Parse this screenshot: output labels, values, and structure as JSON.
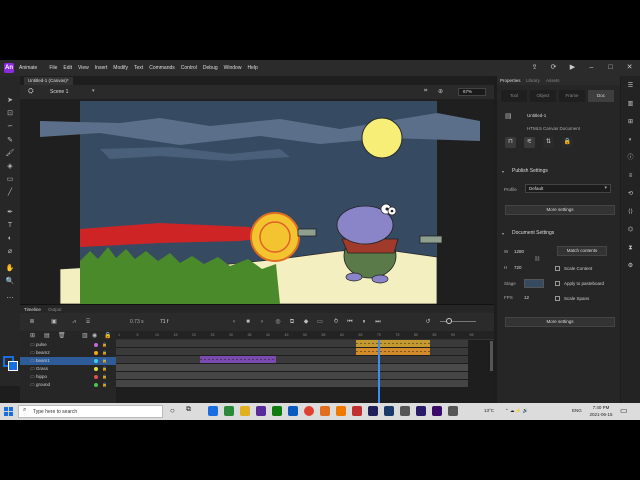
{
  "app": {
    "logo": "An",
    "name": "Animate",
    "menu": [
      "File",
      "Edit",
      "View",
      "Insert",
      "Modify",
      "Text",
      "Commands",
      "Control",
      "Debug",
      "Window",
      "Help"
    ],
    "window_icons": [
      "share-icon",
      "sync-icon",
      "play-icon",
      "minimize-icon",
      "maximize-icon",
      "close-icon"
    ]
  },
  "document": {
    "tab": "Untitled-1 (Canvas)*",
    "scene": "Scene 1",
    "zoom": "67%"
  },
  "timeline": {
    "tabs": [
      "Timeline",
      "Output"
    ],
    "frame_time": "0.73",
    "frame_time_unit": "s",
    "frame_number": "71",
    "frame_unit": "f",
    "ruler_ticks": [
      "1",
      "5",
      "10",
      "15",
      "20",
      "25",
      "30",
      "35",
      "40",
      "45",
      "50",
      "55",
      "60",
      "65",
      "70",
      "75",
      "80",
      "85",
      "90",
      "95"
    ],
    "layers": [
      {
        "name": "pulse",
        "dot": "#c06ad8",
        "selected": false
      },
      {
        "name": "beam2",
        "dot": "#f4a623",
        "selected": false
      },
      {
        "name": "beam1",
        "dot": "#3ecfee",
        "selected": true
      },
      {
        "name": "Grass",
        "dot": "#e0e04a",
        "selected": false
      },
      {
        "name": "hippo",
        "dot": "#e05050",
        "selected": false
      },
      {
        "name": "ground",
        "dot": "#50c050",
        "selected": false
      }
    ]
  },
  "properties": {
    "tabs": [
      "Properties",
      "Library",
      "Assets"
    ],
    "segments": [
      "Tool",
      "Object",
      "Frame",
      "Doc"
    ],
    "active_segment": "Doc",
    "doc_name": "Untitled-1",
    "doc_type": "HTML5 Canvas Document",
    "publish_title": "Publish Settings",
    "profile_label": "Profile",
    "profile_value": "Default",
    "more_settings": "More settings",
    "doc_settings_title": "Document Settings",
    "w_label": "W",
    "w_value": "1280",
    "h_label": "H",
    "h_value": "720",
    "match_contents": "Match contents",
    "scale_content": "Scale Content",
    "apply_pasteboard": "Apply to pasteboard",
    "stage_label": "Stage",
    "fps_label": "FPS",
    "fps_value": "12",
    "scale_spans": "Scale Spans",
    "more_settings_2": "More settings"
  },
  "taskbar": {
    "search_placeholder": "Type here to search",
    "weather": "13°C",
    "lang": "ENG",
    "time": "7:40 PM",
    "date": "2021-06-15"
  },
  "colors": {
    "accent": "#1a6de0",
    "sky": "#364a62",
    "moon": "#f7ee78",
    "beam": "#e02020",
    "ground": "#f4efc0",
    "grass": "#4a8a2a",
    "hippo": "#8a84c8"
  }
}
